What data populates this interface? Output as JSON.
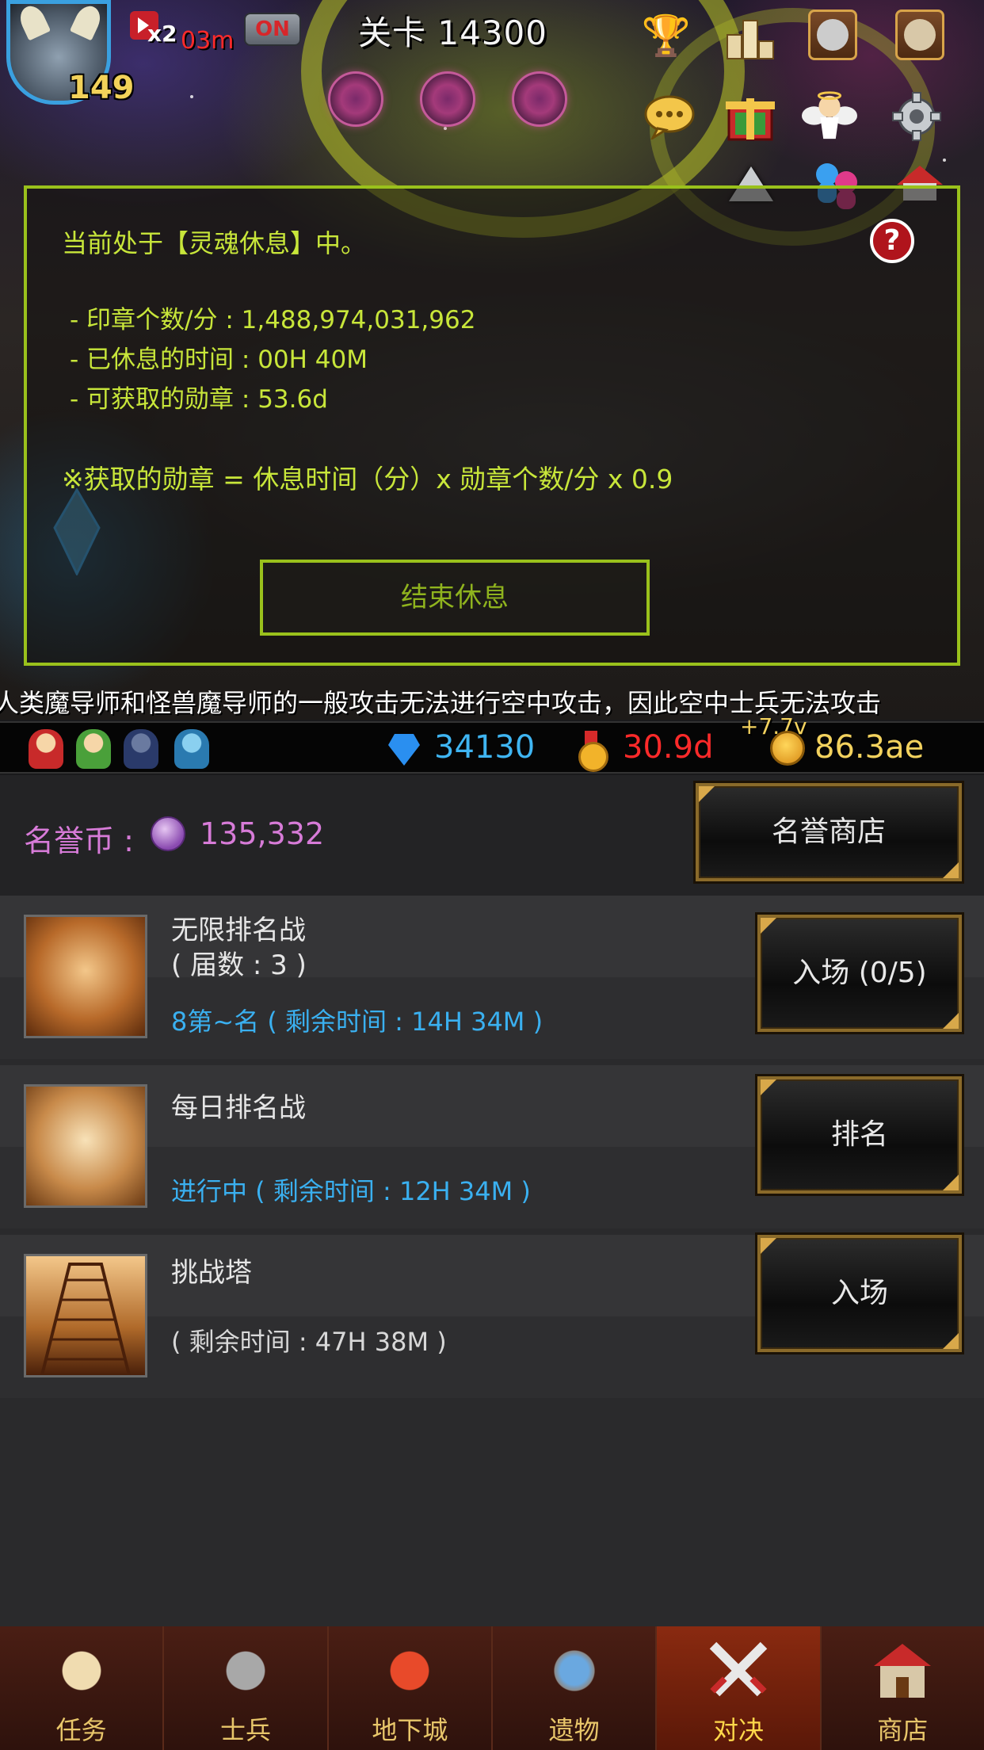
{
  "header": {
    "level": "149",
    "speed_multiplier": "x2",
    "speed_time": "03m",
    "toggle_label": "ON",
    "stage_title": "关卡 14300"
  },
  "dialog": {
    "title": "当前处于【灵魂休息】中。",
    "help": "?",
    "seals_per_min": "- 印章个数/分 : 1,488,974,031,962",
    "rest_time": "- 已休息的时间 : 00H 40M",
    "medals_obtainable": "- 可获取的勋章 : 53.6d",
    "formula": "※获取的勋章 = 休息时间（分）x 勋章个数/分 x 0.9",
    "end_button": "结束休息"
  },
  "ticker": "人类魔导师和怪兽魔导师的一般攻击无法进行空中攻击，因此空中士兵无法攻击",
  "resources": {
    "gems": "34130",
    "medals": "30.9d",
    "gold": "86.3ae",
    "gold_rate": "+7.7v"
  },
  "honor": {
    "label": "名誉币 :",
    "value": "135,332",
    "shop_button": "名誉商店"
  },
  "events": [
    {
      "name": "无限排名战",
      "subname": "( 届数 : 3 )",
      "info": "8第~名 ( 剩余时间 : 14H 34M )",
      "button": "入场 (0/5)"
    },
    {
      "name": "每日排名战",
      "subname": "",
      "info": "进行中 ( 剩余时间 : 12H 34M )",
      "button": "排名"
    },
    {
      "name": "挑战塔",
      "subname": "",
      "info": "( 剩余时间 : 47H 38M )",
      "button": "入场"
    }
  ],
  "nav": {
    "items": [
      {
        "label": "任务"
      },
      {
        "label": "士兵"
      },
      {
        "label": "地下城"
      },
      {
        "label": "遗物"
      },
      {
        "label": "对决"
      },
      {
        "label": "商店"
      }
    ],
    "active": "对决"
  }
}
